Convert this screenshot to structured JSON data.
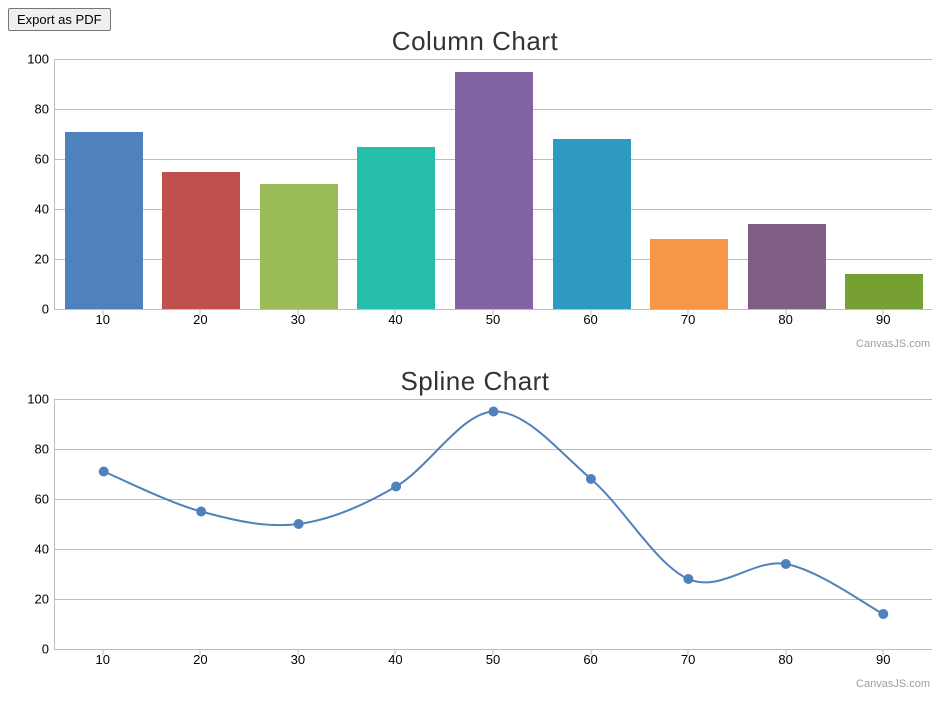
{
  "export_button_label": "Export as PDF",
  "credit_label": "CanvasJS.com",
  "chart_data": [
    {
      "type": "bar",
      "title": "Column Chart",
      "x": [
        10,
        20,
        30,
        40,
        50,
        60,
        70,
        80,
        90
      ],
      "values": [
        71,
        55,
        50,
        65,
        95,
        68,
        28,
        34,
        14
      ],
      "xlabel": "",
      "ylabel": "",
      "ylim": [
        0,
        100
      ],
      "yticks": [
        0,
        20,
        40,
        60,
        80,
        100
      ],
      "colors": [
        "#4f81bc",
        "#c0504e",
        "#9bbb58",
        "#24beaa",
        "#8165a3",
        "#2e9ac1",
        "#f79647",
        "#7f6084",
        "#77a033"
      ]
    },
    {
      "type": "line",
      "title": "Spline Chart",
      "x": [
        10,
        20,
        30,
        40,
        50,
        60,
        70,
        80,
        90
      ],
      "values": [
        71,
        55,
        50,
        65,
        95,
        68,
        28,
        34,
        14
      ],
      "xlabel": "",
      "ylabel": "",
      "ylim": [
        0,
        100
      ],
      "yticks": [
        0,
        20,
        40,
        60,
        80,
        100
      ],
      "line_color": "#4f81bc"
    }
  ]
}
